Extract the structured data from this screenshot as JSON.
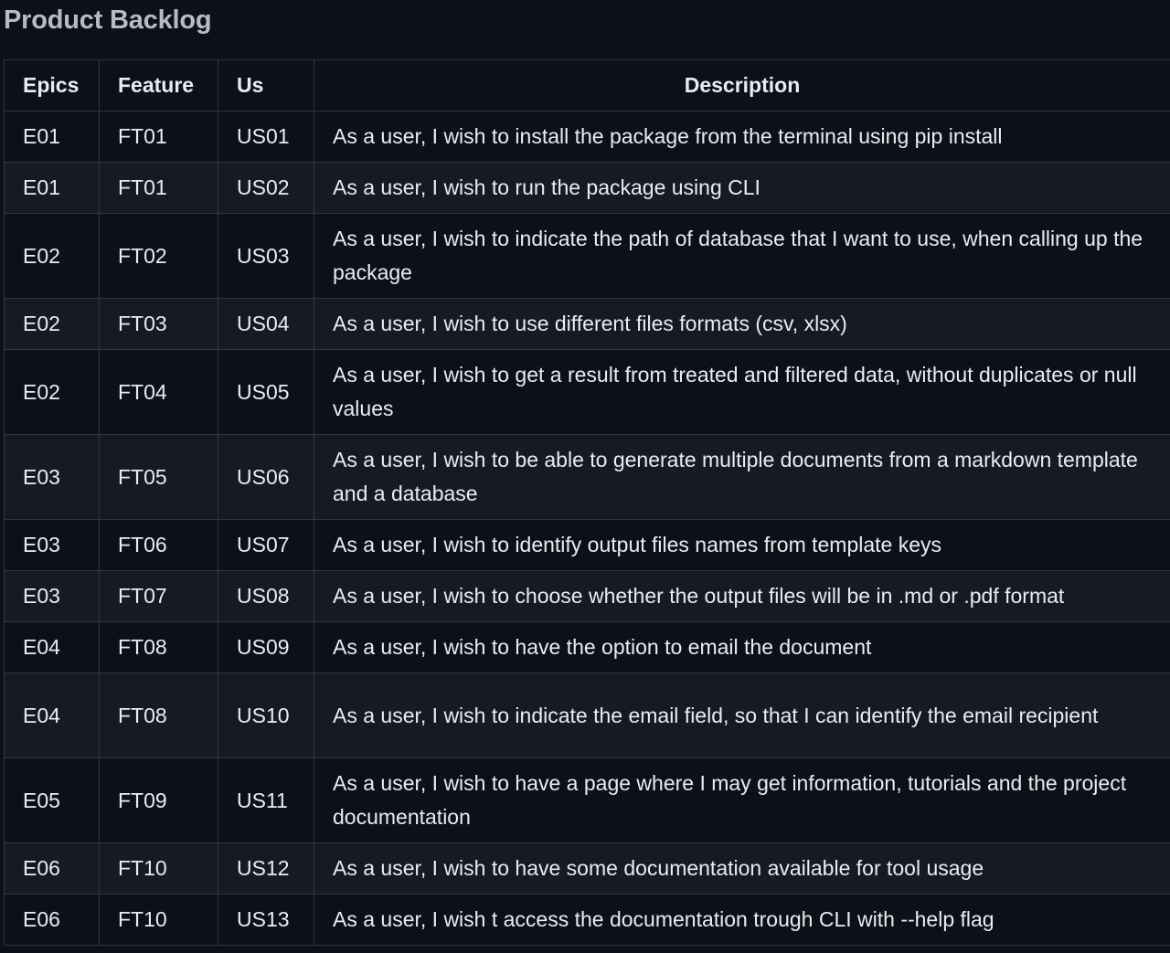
{
  "title": "Product Backlog",
  "headers": {
    "epics": "Epics",
    "feature": "Feature",
    "us": "Us",
    "description": "Description"
  },
  "rows": [
    {
      "epic": "E01",
      "feature": "FT01",
      "us": "US01",
      "description": "As a user, I wish to install the package from the terminal using pip install"
    },
    {
      "epic": "E01",
      "feature": "FT01",
      "us": "US02",
      "description": "As a user, I wish to run the package using CLI"
    },
    {
      "epic": "E02",
      "feature": "FT02",
      "us": "US03",
      "description": "As a user, I wish to indicate the path of database that I want to use, when calling up the package"
    },
    {
      "epic": "E02",
      "feature": "FT03",
      "us": "US04",
      "description": "As a user, I wish to use different files formats (csv, xlsx)"
    },
    {
      "epic": "E02",
      "feature": "FT04",
      "us": "US05",
      "description": "As a user, I wish to get a result from treated and filtered data, without duplicates or null values"
    },
    {
      "epic": "E03",
      "feature": "FT05",
      "us": "US06",
      "description": "As a user, I wish to be able to generate multiple documents from a markdown template and a database"
    },
    {
      "epic": "E03",
      "feature": "FT06",
      "us": "US07",
      "description": "As a user, I wish to identify output files names from template keys"
    },
    {
      "epic": "E03",
      "feature": "FT07",
      "us": "US08",
      "description": "As a user, I wish to choose whether the output files will be in .md or .pdf format"
    },
    {
      "epic": "E04",
      "feature": "FT08",
      "us": "US09",
      "description": "As a user, I wish to have the option to email the document"
    },
    {
      "epic": "E04",
      "feature": "FT08",
      "us": "US10",
      "description": "As a user, I wish to indicate the email field, so that I can identify the email recipient"
    },
    {
      "epic": "E05",
      "feature": "FT09",
      "us": "US11",
      "description": "As a user, I wish to have a page where I may get information, tutorials and the project documentation"
    },
    {
      "epic": "E06",
      "feature": "FT10",
      "us": "US12",
      "description": "As a user, I wish to have some documentation available for tool usage"
    },
    {
      "epic": "E06",
      "feature": "FT10",
      "us": "US13",
      "description": "As a user, I wish t access the documentation trough CLI with --help flag"
    }
  ],
  "colors": {
    "background": "#0d1117",
    "row_alt": "#161b22",
    "border": "#30363d",
    "text": "#e6edf3",
    "title": "#b6bcc4"
  }
}
